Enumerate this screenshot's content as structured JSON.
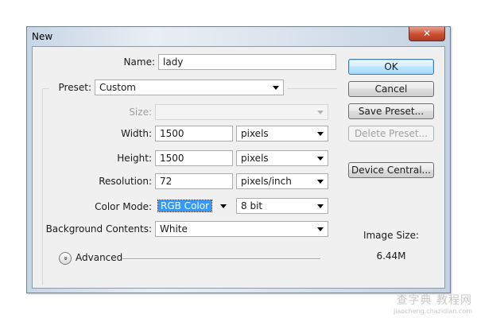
{
  "window": {
    "title": "New",
    "close_glyph": "✕"
  },
  "form": {
    "name_label": "Name:",
    "name_value": "lady",
    "preset_label": "Preset:",
    "preset_value": "Custom",
    "size_label": "Size:",
    "size_value": "",
    "width_label": "Width:",
    "width_value": "1500",
    "width_unit": "pixels",
    "height_label": "Height:",
    "height_value": "1500",
    "height_unit": "pixels",
    "resolution_label": "Resolution:",
    "resolution_value": "72",
    "resolution_unit": "pixels/inch",
    "color_mode_label": "Color Mode:",
    "color_mode_value": "RGB Color",
    "bit_depth_value": "8 bit",
    "background_label": "Background Contents:",
    "background_value": "White",
    "advanced_label": "Advanced",
    "advanced_glyph": "»"
  },
  "buttons": {
    "ok": "OK",
    "cancel": "Cancel",
    "save_preset": "Save Preset...",
    "delete_preset": "Delete Preset...",
    "device_central": "Device Central..."
  },
  "image_size": {
    "label": "Image Size:",
    "value": "6.44M"
  },
  "watermark": {
    "text": "查字典 教程网",
    "url": "jiaocheng.chazidian.com"
  },
  "colors": {
    "highlight": "#3399ff",
    "close": "#c94d33",
    "default_button_border": "#3c7fb1"
  }
}
